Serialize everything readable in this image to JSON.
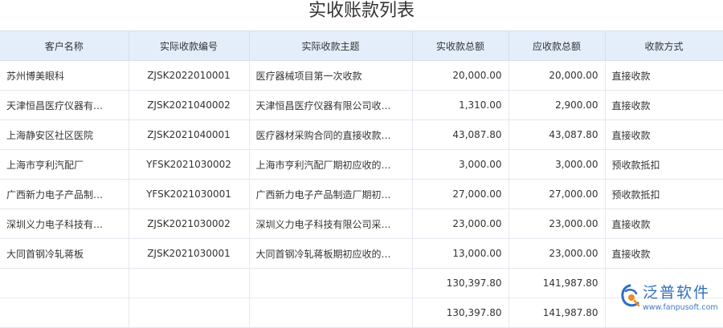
{
  "page": {
    "title": "实收账款列表"
  },
  "table": {
    "columns": [
      "客户名称",
      "实际收款编号",
      "实际收款主题",
      "实收款总额",
      "应收款总额",
      "收款方式"
    ],
    "rows": [
      {
        "customer": "苏州博美眼科",
        "code": "ZJSK2022010001",
        "subject": "医疗器械项目第一次收款",
        "received": "20,000.00",
        "receivable": "20,000.00",
        "method": "直接收款"
      },
      {
        "customer": "天津恒昌医疗仪器有…",
        "code": "ZJSK2021040002",
        "subject": "天津恒昌医疗仪器有限公司收…",
        "received": "1,310.00",
        "receivable": "2,900.00",
        "method": "直接收款"
      },
      {
        "customer": "上海静安区社区医院",
        "code": "ZJSK2021040001",
        "subject": "医疗器材采购合同的直接收款…",
        "received": "43,087.80",
        "receivable": "43,087.80",
        "method": "直接收款"
      },
      {
        "customer": "上海市亨利汽配厂",
        "code": "YFSK2021030002",
        "subject": "上海市亨利汽配厂期初应收的…",
        "received": "3,000.00",
        "receivable": "3,000.00",
        "method": "预收款抵扣"
      },
      {
        "customer": "广西新力电子产品制…",
        "code": "YFSK2021030001",
        "subject": "广西新力电子产品制造厂期初…",
        "received": "27,000.00",
        "receivable": "27,000.00",
        "method": "预收款抵扣"
      },
      {
        "customer": "深圳义力电子科技有…",
        "code": "ZJSK2021030002",
        "subject": "深圳义力电子科技有限公司采…",
        "received": "23,000.00",
        "receivable": "23,000.00",
        "method": "直接收款"
      },
      {
        "customer": "大同首钢冷轧蒋板",
        "code": "ZJSK2021030001",
        "subject": "大同首钢冷轧蒋板期初应收的…",
        "received": "13,000.00",
        "receivable": "23,000.00",
        "method": "直接收款"
      }
    ],
    "totals": [
      {
        "received": "130,397.80",
        "receivable": "141,987.80"
      },
      {
        "received": "130,397.80",
        "receivable": "141,987.80"
      }
    ]
  },
  "logo": {
    "text": "泛普软件",
    "url": "www.fanpusoft.com",
    "colors": {
      "blue": "#2f6fbf",
      "orange": "#f08a24"
    }
  }
}
